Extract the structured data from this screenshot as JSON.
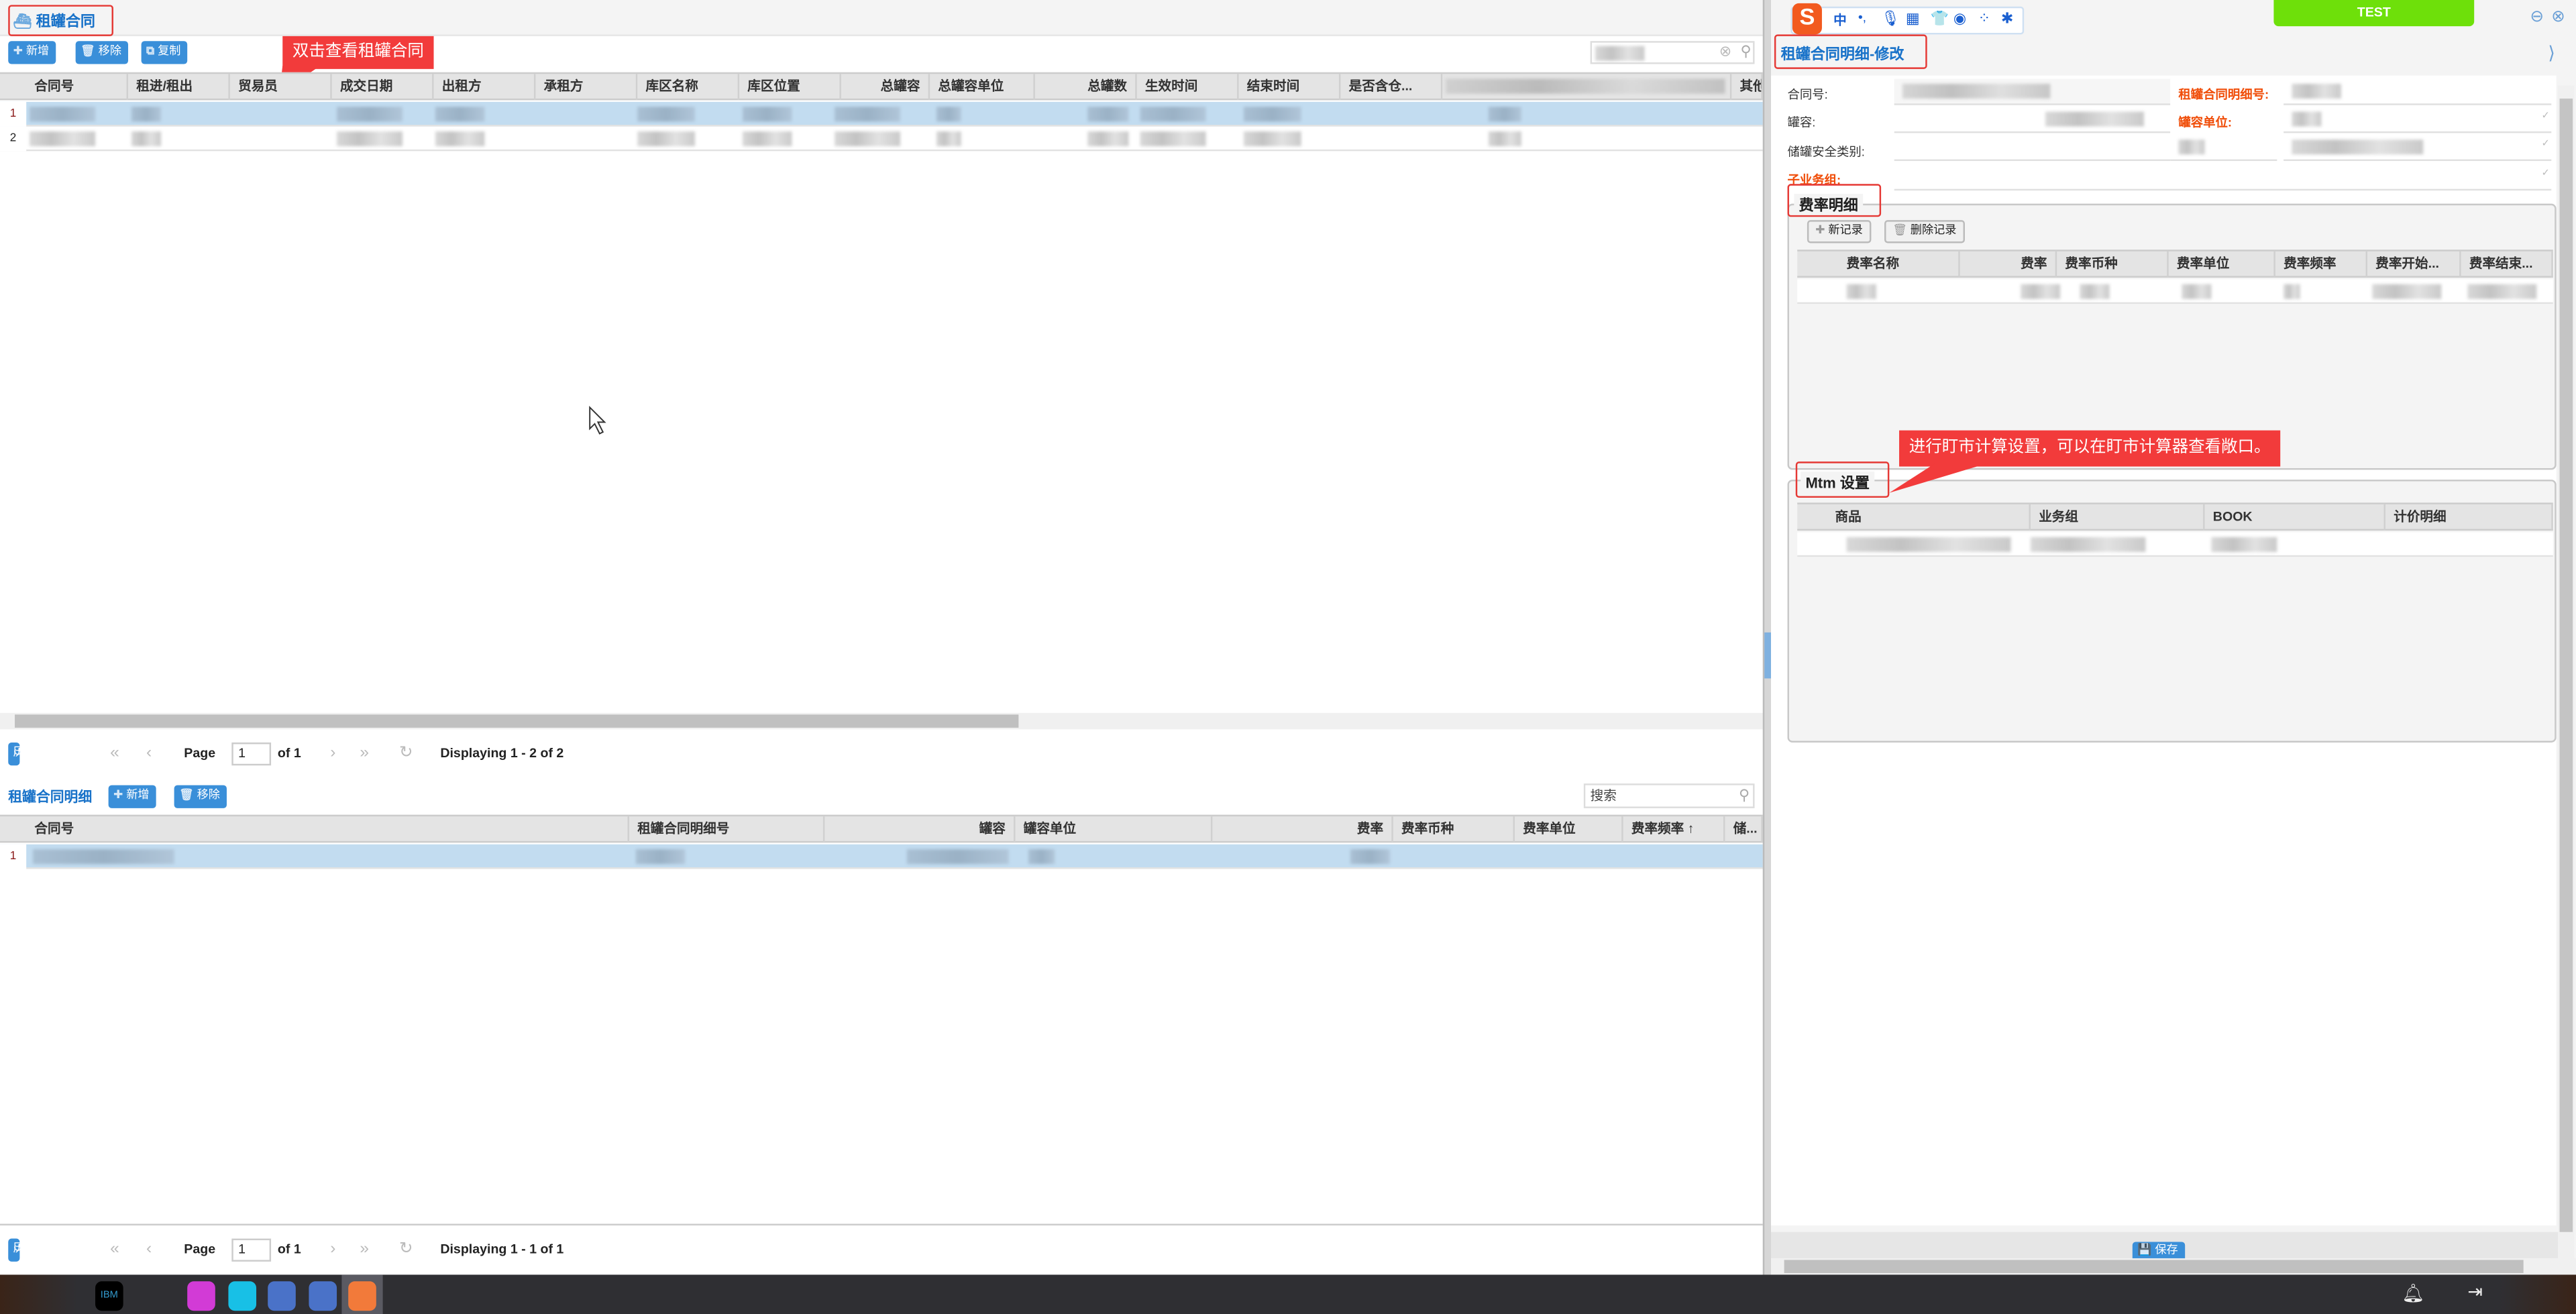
{
  "left": {
    "title": "租罐合同",
    "toolbar": {
      "add": "新增",
      "remove": "移除",
      "copy": "复制"
    },
    "callout": "双击查看租罐合同",
    "columns": [
      "合同号",
      "租进/租出",
      "贸易员",
      "成交日期",
      "出租方",
      "承租方",
      "库区名称",
      "库区位置",
      "总罐容",
      "总罐容单位",
      "总罐数",
      "生效时间",
      "结束时间",
      "是否含仓...",
      "其他"
    ],
    "row_numbers": [
      "1",
      "2"
    ],
    "pager": {
      "history": "历史记录",
      "page_label": "Page",
      "page_value": "1",
      "of": "of 1",
      "display": "Displaying 1 - 2 of 2"
    },
    "detail": {
      "title": "租罐合同明细",
      "add": "新增",
      "remove": "移除",
      "search_placeholder": "搜索",
      "columns": [
        "合同号",
        "租罐合同明细号",
        "罐容",
        "罐容单位",
        "费率",
        "费率币种",
        "费率单位",
        "费率频率 ↑",
        "储..."
      ],
      "row_numbers": [
        "1"
      ],
      "pager": {
        "history": "历史记录",
        "page_label": "Page",
        "page_value": "1",
        "of": "of 1",
        "display": "Displaying 1 - 1 of 1"
      }
    }
  },
  "right": {
    "env_badge": "TEST",
    "ime": {
      "logo": "S",
      "mode": "中",
      "punct": "•,",
      "icons": [
        "mic-icon",
        "keyboard-icon",
        "skin-icon",
        "robot-icon",
        "apps-icon",
        "settings-icon"
      ]
    },
    "title": "租罐合同明细-修改",
    "form": {
      "contract_no": "合同号:",
      "detail_no": "租罐合同明细号:",
      "capacity": "罐容:",
      "capacity_unit": "罐容单位:",
      "safety_class": "储罐安全类别:",
      "sub_group": "子业务组:"
    },
    "rates": {
      "legend": "费率明细",
      "new": "新记录",
      "delete": "删除记录",
      "columns": [
        "费率名称",
        "费率",
        "费率币种",
        "费率单位",
        "费率频率",
        "费率开始...",
        "费率结束..."
      ]
    },
    "callout": "进行盯市计算设置，可以在盯市计算器查看敞口。",
    "mtm": {
      "legend": "Mtm 设置",
      "columns": [
        "商品",
        "业务组",
        "BOOK",
        "计价明细"
      ]
    },
    "save": "保存"
  },
  "colors": {
    "accent": "#3a8fd9",
    "callout": "#f23b3b",
    "required": "#f04e0a",
    "env": "#6ee00a",
    "selected_row": "#c2dcf0"
  }
}
